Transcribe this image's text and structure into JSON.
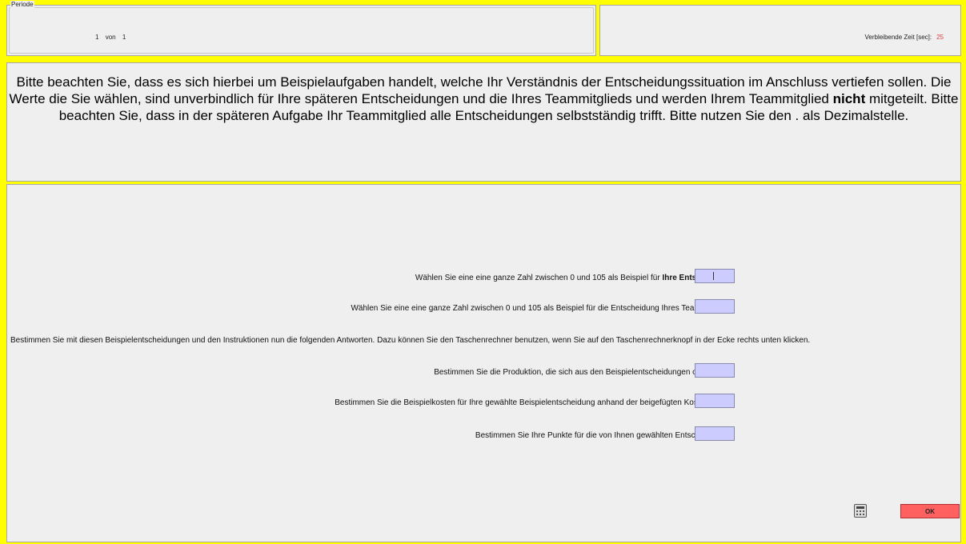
{
  "period": {
    "legend": "Periode",
    "current": "1",
    "separator": "von",
    "total": "1"
  },
  "timer": {
    "label": "Verbleibende Zeit [sec]:",
    "value": "25"
  },
  "instructions": {
    "part1": "Bitte beachten Sie, dass es sich hierbei um Beispielaufgaben handelt, welche Ihr Verständnis der Entscheidungssituation im Anschluss vertiefen sollen. Die Werte die Sie wählen, sind unverbindlich für Ihre späteren Entscheidungen und die Ihres Teammitglieds und werden Ihrem Teammitglied ",
    "bold": "nicht",
    "part2": " mitgeteilt. Bitte beachten Sie, dass in der späteren Aufgabe Ihr Teammitglied alle Entscheidungen selbstständig trifft. Bitte nutzen Sie den . als Dezimalstelle."
  },
  "questions": {
    "own_decision_prefix": "Wählen Sie eine eine ganze Zahl zwischen 0 und 105 als Beispiel für ",
    "own_decision_bold": "Ihre Entscheidung:",
    "own_decision_value": "",
    "team_decision_label": "Wählen Sie eine eine ganze Zahl zwischen 0 und 105 als Beispiel für die Entscheidung Ihres Teammitglieds:",
    "team_decision_value": "",
    "info_text": "Bestimmen Sie mit diesen Beispielentscheidungen und den Instruktionen nun die folgenden Antworten. Dazu können Sie den Taschenrechner benutzen, wenn Sie auf den Taschenrechnerknopf in der Ecke rechts unten klicken.",
    "production_label": "Bestimmen Sie die Produktion, die sich aus den Beispielentscheidungen oben ergibt:",
    "production_value": "",
    "costs_label": "Bestimmen Sie die Beispielkosten für Ihre gewählte Beispielentscheidung anhand der beigefügten Kostentabelle:",
    "costs_value": "",
    "points_label": "Bestimmen Sie Ihre Punkte für die von Ihnen gewählten Entscheidungen:",
    "points_value": ""
  },
  "buttons": {
    "ok_label": "OK",
    "calculator_icon": "calculator-icon"
  },
  "colors": {
    "background": "#ffff00",
    "input": "#ccccff",
    "ok_button": "#ff6060",
    "timer_value": "#e04040"
  }
}
